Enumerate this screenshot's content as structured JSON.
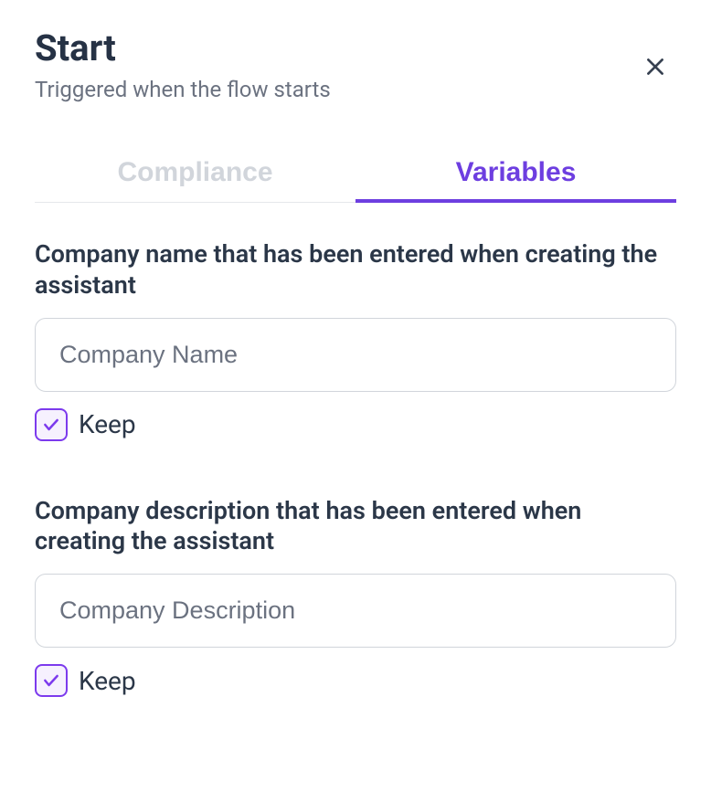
{
  "header": {
    "title": "Start",
    "subtitle": "Triggered when the flow starts"
  },
  "tabs": [
    {
      "label": "Compliance",
      "active": false
    },
    {
      "label": "Variables",
      "active": true
    }
  ],
  "fields": [
    {
      "label": "Company name that has been entered when creating the assistant",
      "placeholder": "Company Name",
      "value": "",
      "keep_label": "Keep",
      "keep_checked": true
    },
    {
      "label": "Company description that has been entered when creating the assistant",
      "placeholder": "Company Description",
      "value": "",
      "keep_label": "Keep",
      "keep_checked": true
    }
  ]
}
